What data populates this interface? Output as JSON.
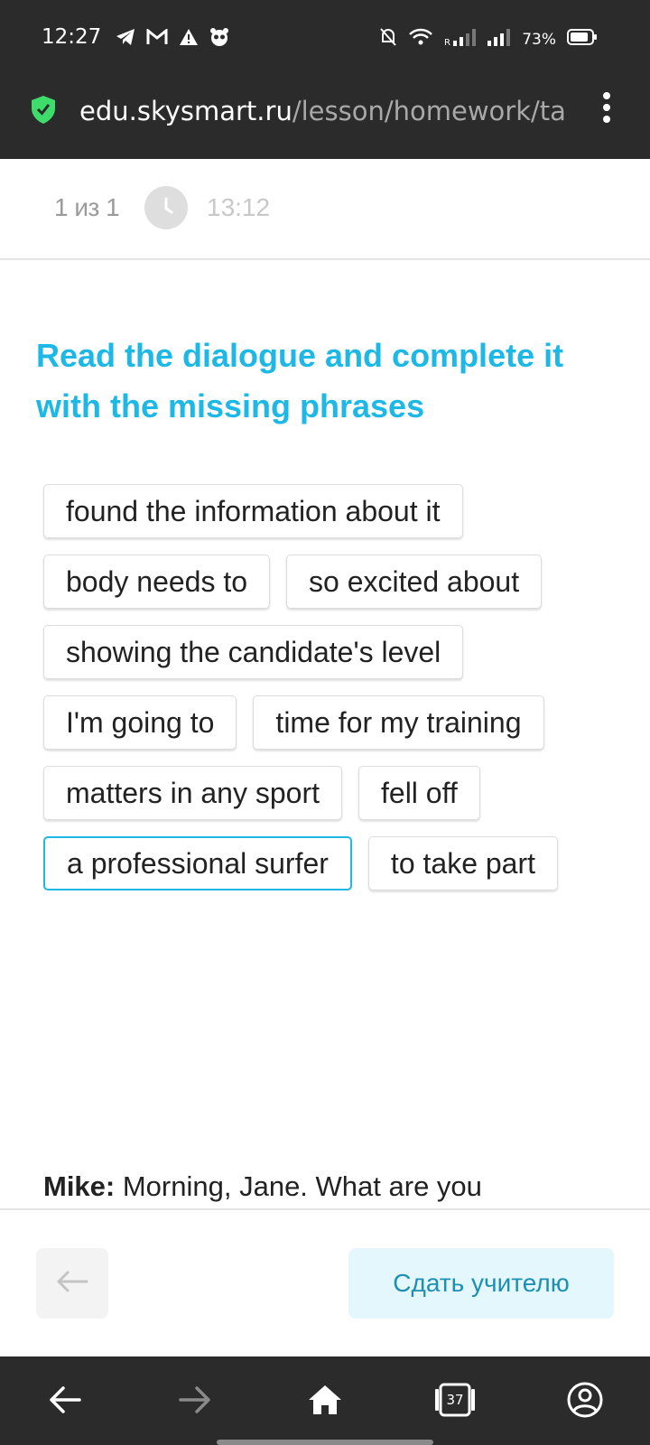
{
  "status_bar": {
    "time": "12:27",
    "battery": "73%",
    "left_icons": [
      "telegram-icon",
      "gmail-icon",
      "warning-icon",
      "panda-icon"
    ],
    "right_icons": [
      "mute-icon",
      "wifi-icon",
      "signal-icon",
      "signal-icon",
      "battery-icon"
    ]
  },
  "browser": {
    "url_host": "edu.skysmart.ru",
    "url_path": "/lesson/homework/ta",
    "secure_icon": "shield-check-icon",
    "shield_color": "#3ddc6b"
  },
  "progress": {
    "count": "1 из 1",
    "timer": "13:12"
  },
  "task": {
    "title": "Read the dialogue and complete it with the missing phrases",
    "accent_color": "#1db8e6",
    "phrases": [
      "found the information about it",
      "body needs to",
      "so excited about",
      "showing the candidate's level",
      "I'm going to",
      "time for my training",
      "matters in any sport",
      "fell off",
      "a professional surfer",
      "to take part"
    ],
    "selected_phrase": "a professional surfer",
    "dialogue_speaker": "Mike:",
    "dialogue_text": " Morning, Jane. What are you"
  },
  "actions": {
    "back_icon": "arrow-left-icon",
    "submit_label": "Сдать учителю"
  },
  "nav": {
    "tabs_count": "37"
  }
}
